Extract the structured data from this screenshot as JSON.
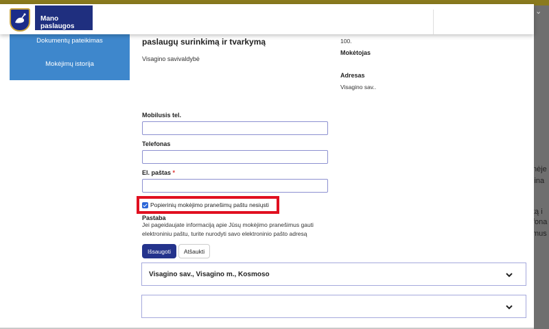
{
  "brand": {
    "name": "Mano paslaugos",
    "logo_icon": "crest-icon"
  },
  "sidebar": {
    "items": [
      {
        "label": "Dokumentų pateikimas"
      },
      {
        "label": "Mokėjimų istorija"
      }
    ]
  },
  "service": {
    "title": "paslaugų surinkimą ir tvarkymą",
    "municipality": "Visagino savivaldybė"
  },
  "payer_info": {
    "amount": "100.",
    "payer_label": "Mokėtojas",
    "address_label": "Adresas",
    "address_value": "Visagino sav.."
  },
  "form": {
    "mobile": {
      "label": "Mobilusis tel.",
      "value": ""
    },
    "phone": {
      "label": "Telefonas",
      "value": ""
    },
    "email": {
      "label": "El. paštas",
      "required_mark": "*",
      "value": ""
    },
    "paper_checkbox": {
      "label": "Popierinių mokėjimo pranešimų paštu nesiųsti",
      "checked": true
    },
    "note_label": "Pastaba",
    "help_lines": [
      "Jei pageidaujate informaciją apie Jūsų mokėjimo pranešimus gauti",
      "elektroniniu paštu, turite nurodyti savo elektroninio pašto adresą"
    ],
    "save_label": "Išsaugoti",
    "cancel_label": "Atšaukti"
  },
  "accordions": [
    {
      "title": "Visagino sav., Visagino m., Kosmoso",
      "icon": "chevron-down-icon"
    },
    {
      "title": "",
      "icon": "chevron-down-icon"
    }
  ],
  "background": {
    "right_text_lines": [
      "nėje",
      "lina",
      "",
      "tą i",
      "fona",
      "mus"
    ]
  },
  "colors": {
    "brand_navy": "#1f2f7f",
    "sidebar_blue": "#3e87cc",
    "highlight_red": "#e01020",
    "input_border": "#8b8fd0"
  }
}
